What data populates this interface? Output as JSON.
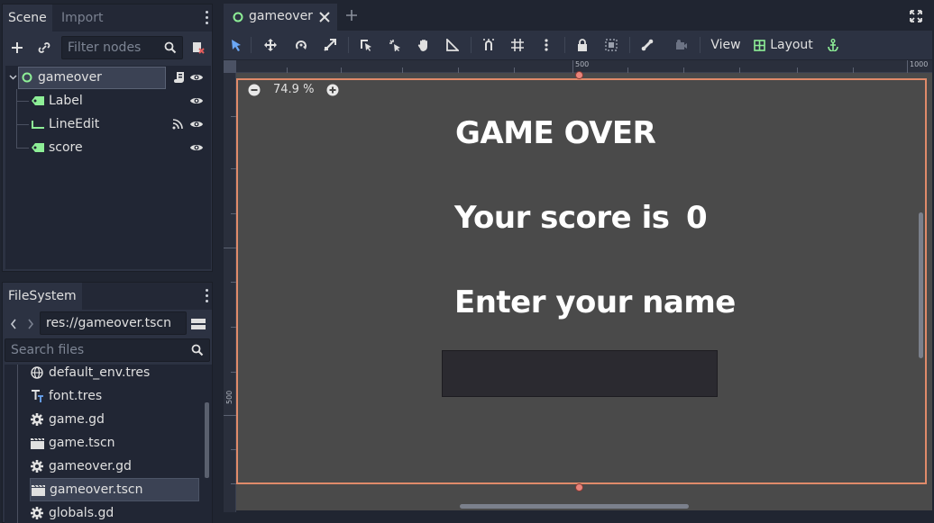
{
  "scene_dock": {
    "tabs": [
      "Scene",
      "Import"
    ],
    "filter_placeholder": "Filter nodes",
    "nodes": [
      {
        "name": "gameover",
        "type": "Control"
      },
      {
        "name": "Label",
        "type": "Label"
      },
      {
        "name": "LineEdit",
        "type": "LineEdit"
      },
      {
        "name": "score",
        "type": "Label"
      }
    ]
  },
  "filesystem_dock": {
    "tab": "FileSystem",
    "path": "res://gameover.tscn",
    "search_placeholder": "Search files",
    "files": [
      {
        "name": "default_env.tres",
        "icon": "globe-icon"
      },
      {
        "name": "font.tres",
        "icon": "font-icon"
      },
      {
        "name": "game.gd",
        "icon": "gear-icon"
      },
      {
        "name": "game.tscn",
        "icon": "clapper-icon"
      },
      {
        "name": "gameover.gd",
        "icon": "gear-icon"
      },
      {
        "name": "gameover.tscn",
        "icon": "clapper-icon",
        "selected": true
      },
      {
        "name": "globals.gd",
        "icon": "gear-icon"
      }
    ]
  },
  "editor": {
    "scene_tab": "gameover",
    "toolbar": {
      "view_label": "View",
      "layout_label": "Layout"
    },
    "zoom": "74.9 %",
    "ruler_top_labels": [
      "500",
      "1000"
    ],
    "ruler_left_labels": [
      "500"
    ],
    "canvas_texts": {
      "title": "GAME OVER",
      "score_label": "Your score is",
      "score_value": "0",
      "name_prompt": "Enter your name"
    }
  },
  "colors": {
    "selection_frame": "#e08a6a",
    "canvas_bg": "#4a4a4a",
    "node_icon_green": "#8eef97",
    "accent_blue": "#6ba7f5"
  }
}
